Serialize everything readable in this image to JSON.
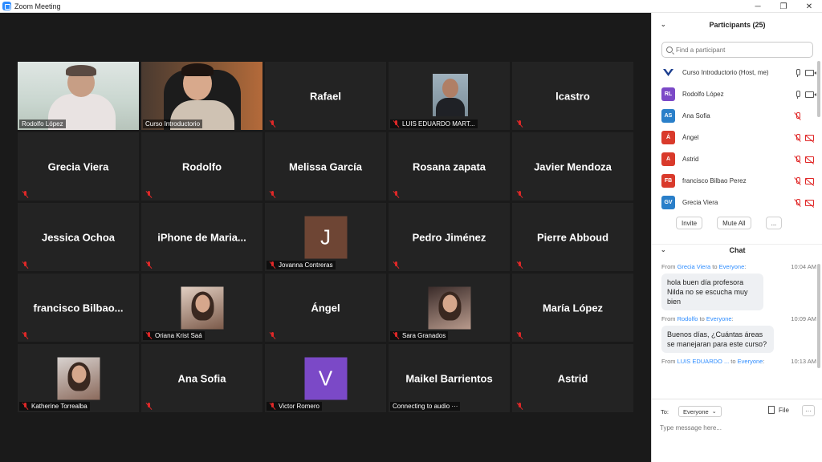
{
  "window": {
    "title": "Zoom Meeting",
    "controls": {
      "minimize": "─",
      "maximize": "❐",
      "close": "✕"
    }
  },
  "colors": {
    "background": "#1a1a1a",
    "tile": "#232323",
    "active_speaker_border": "#c8e62d",
    "muted_icon": "#e02828",
    "link_blue": "#2d8cff"
  },
  "grid": {
    "tiles": [
      {
        "kind": "video",
        "scene": "rodolfo",
        "label": "Rodolfo López",
        "muted": false,
        "active": true
      },
      {
        "kind": "video",
        "scene": "curso",
        "label": "Curso Introductorio",
        "muted": false,
        "active": false
      },
      {
        "kind": "name",
        "name": "Rafael",
        "muted": true
      },
      {
        "kind": "photo",
        "photo": "luis",
        "label": "LUIS EDUARDO MART...",
        "muted": true
      },
      {
        "kind": "name",
        "name": "lcastro",
        "muted": true
      },
      {
        "kind": "name",
        "name": "Grecia Viera",
        "muted": true
      },
      {
        "kind": "name",
        "name": "Rodolfo",
        "muted": true
      },
      {
        "kind": "name",
        "name": "Melissa García",
        "muted": true
      },
      {
        "kind": "name",
        "name": "Rosana zapata",
        "muted": true
      },
      {
        "kind": "name",
        "name": "Javier Mendoza",
        "muted": true
      },
      {
        "kind": "name",
        "name": "Jessica Ochoa",
        "muted": true
      },
      {
        "kind": "name",
        "name": "iPhone de Maria...",
        "muted": true
      },
      {
        "kind": "letter",
        "letter": "J",
        "color": "#6e4534",
        "label": "Jovanna Contreras",
        "muted": true
      },
      {
        "kind": "name",
        "name": "Pedro Jiménez",
        "muted": true
      },
      {
        "kind": "name",
        "name": "Pierre Abboud",
        "muted": true
      },
      {
        "kind": "name",
        "name": "francisco Bilbao...",
        "muted": true
      },
      {
        "kind": "photo",
        "photo": "oriana",
        "label": "Oriana Krist Saá",
        "muted": true
      },
      {
        "kind": "name",
        "name": "Ángel",
        "muted": true
      },
      {
        "kind": "photo",
        "photo": "sara",
        "label": "Sara Granados",
        "muted": true
      },
      {
        "kind": "name",
        "name": "María López",
        "muted": true
      },
      {
        "kind": "photo",
        "photo": "kath",
        "label": "Katherine Torrealba",
        "muted": true
      },
      {
        "kind": "name",
        "name": "Ana Sofia",
        "muted": true
      },
      {
        "kind": "letter",
        "letter": "V",
        "color": "#7b49c7",
        "label": "Victor Romero",
        "muted": true
      },
      {
        "kind": "name",
        "name": "Maikel Barrientos",
        "label": "Connecting to audio ···",
        "muted": false
      },
      {
        "kind": "name",
        "name": "Astrid",
        "muted": true
      }
    ]
  },
  "participants": {
    "title": "Participants (25)",
    "search_placeholder": "Find a participant",
    "list": [
      {
        "initials": "",
        "avatar_color": "#ffffff",
        "name": "Curso Introductorio (Host, me)",
        "mic": "on",
        "cam": "on",
        "logo": true
      },
      {
        "initials": "RL",
        "avatar_color": "#7b49c7",
        "name": "Rodolfo López",
        "mic": "on",
        "cam": "on"
      },
      {
        "initials": "AS",
        "avatar_color": "#2a7fc9",
        "name": "Ana Sofia",
        "mic": "off",
        "cam": "none"
      },
      {
        "initials": "Á",
        "avatar_color": "#d93a2b",
        "name": "Ángel",
        "mic": "off",
        "cam": "off"
      },
      {
        "initials": "A",
        "avatar_color": "#d93a2b",
        "name": "Astrid",
        "mic": "off",
        "cam": "off"
      },
      {
        "initials": "FB",
        "avatar_color": "#d93a2b",
        "name": "francisco Bilbao Perez",
        "mic": "off",
        "cam": "off"
      },
      {
        "initials": "GV",
        "avatar_color": "#2a7fc9",
        "name": "Grecia Viera",
        "mic": "off",
        "cam": "off"
      }
    ],
    "buttons": {
      "invite": "Invite",
      "mute_all": "Mute All",
      "more": "..."
    }
  },
  "chat": {
    "title": "Chat",
    "messages": [
      {
        "from": "Grecia Viera",
        "to": "Everyone",
        "time": "10:04 AM",
        "text": "hola buen día profesora Nilda no se escucha muy bien"
      },
      {
        "from": "Rodolfo",
        "to": "Everyone",
        "time": "10:09 AM",
        "text": "Buenos días, ¿Cuántas áreas se manejaran para este curso?"
      },
      {
        "from": "LUIS EDUARDO ...",
        "to": "Everyone",
        "time": "10:13 AM",
        "text": ""
      }
    ],
    "from_word": "From",
    "to_word": "to",
    "to_label": "To:",
    "to_value": "Everyone",
    "file_label": "File",
    "more_label": "···",
    "input_placeholder": "Type message here..."
  }
}
